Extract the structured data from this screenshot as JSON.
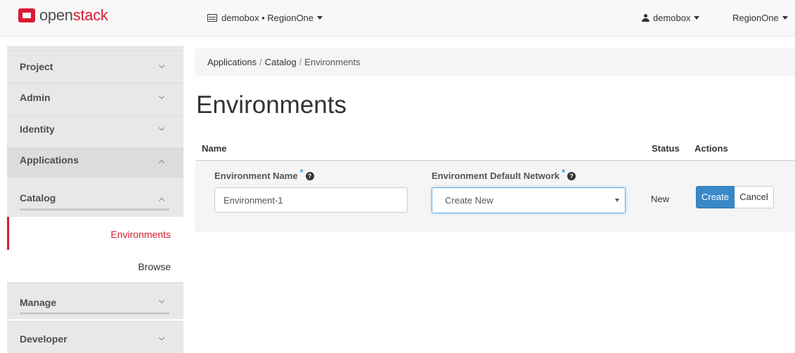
{
  "brand": {
    "part1": "open",
    "part2": "stack",
    "logo_color": "#da1a32"
  },
  "navbar": {
    "project_context": "demobox • RegionOne",
    "user": "demobox",
    "region": "RegionOne"
  },
  "sidebar": {
    "sections": [
      {
        "label": "Project",
        "state": "collapsed"
      },
      {
        "label": "Admin",
        "state": "collapsed"
      },
      {
        "label": "Identity",
        "state": "collapsed"
      },
      {
        "label": "Applications",
        "state": "expanded"
      },
      {
        "label": "Catalog",
        "state": "expanded"
      },
      {
        "label": "Manage",
        "state": "collapsed"
      },
      {
        "label": "Developer",
        "state": "collapsed"
      }
    ],
    "links": [
      {
        "label": "Environments",
        "active": true
      },
      {
        "label": "Browse",
        "active": false
      }
    ]
  },
  "breadcrumb": {
    "items": [
      "Applications",
      "Catalog",
      "Environments"
    ]
  },
  "page": {
    "title": "Environments"
  },
  "table": {
    "headers": {
      "name": "Name",
      "status": "Status",
      "actions": "Actions"
    },
    "form": {
      "name_label": "Environment Name",
      "name_value": "Environment-1",
      "network_label": "Environment Default Network",
      "network_value": "Create New",
      "required_mark": "*",
      "help_glyph": "?",
      "status": "New",
      "create_label": "Create",
      "cancel_label": "Cancel"
    }
  },
  "colors": {
    "accent": "#da1a32",
    "primary_button": "#3a88c8",
    "focus_border": "#66afe9"
  }
}
